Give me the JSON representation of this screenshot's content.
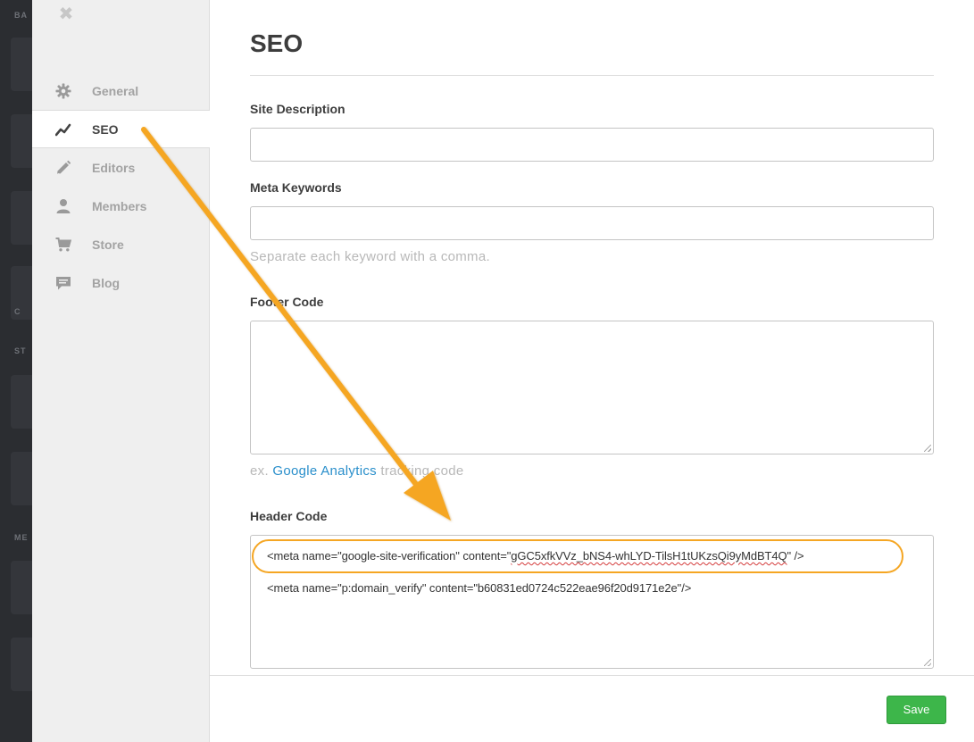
{
  "background_hints": {
    "labels": [
      "BA",
      "C",
      "ST",
      "ME"
    ]
  },
  "sidebar": {
    "close_icon": "close-icon",
    "items": [
      {
        "label": "General",
        "icon": "gear-icon",
        "active": false
      },
      {
        "label": "SEO",
        "icon": "trending-icon",
        "active": true
      },
      {
        "label": "Editors",
        "icon": "pencil-icon",
        "active": false
      },
      {
        "label": "Members",
        "icon": "person-icon",
        "active": false
      },
      {
        "label": "Store",
        "icon": "cart-icon",
        "active": false
      },
      {
        "label": "Blog",
        "icon": "comment-icon",
        "active": false
      }
    ]
  },
  "main": {
    "title": "SEO",
    "site_description": {
      "label": "Site Description",
      "value": ""
    },
    "meta_keywords": {
      "label": "Meta Keywords",
      "value": "",
      "help": "Separate each keyword with a comma."
    },
    "footer_code": {
      "label": "Footer Code",
      "value": "",
      "help_prefix": "ex. ",
      "help_link": "Google Analytics",
      "help_suffix": " tracking code"
    },
    "header_code": {
      "label": "Header Code",
      "line1_prefix": "<meta name=\"google-site-verification\" content=\"",
      "line1_token": "gGC5xfkVVz_bNS4-whLYD-TilsH1tUKzsQi9yMdBT4Q",
      "line1_suffix": "\" />",
      "line2": "<meta name=\"p:domain_verify\" content=\"b60831ed0724c522eae96f20d9171e2e\"/>"
    }
  },
  "footer": {
    "save_label": "Save"
  },
  "colors": {
    "accent_orange": "#f5a623",
    "save_green": "#3db64a",
    "link_blue": "#2a8fcb",
    "sidebar_bg": "#efefef"
  }
}
